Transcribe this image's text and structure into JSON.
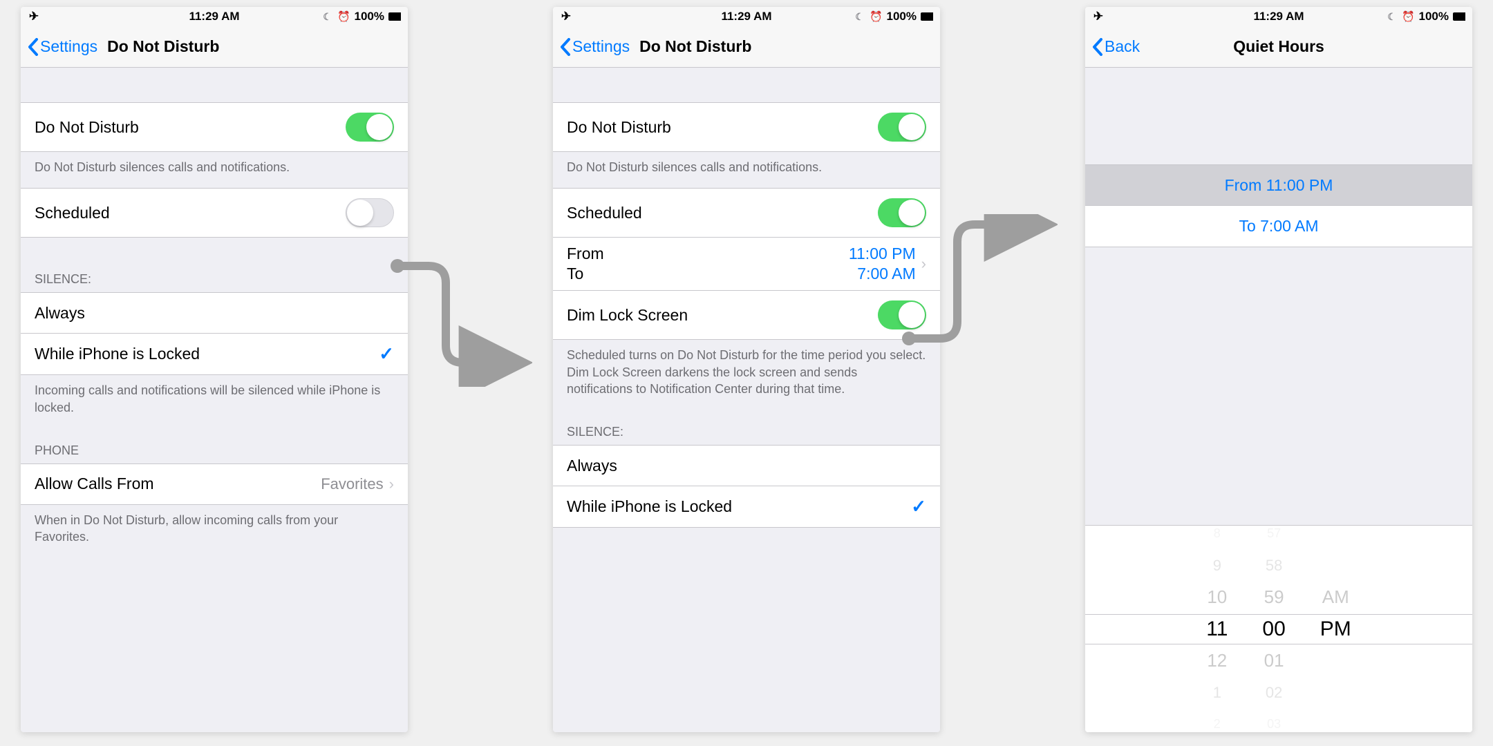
{
  "status_bar": {
    "time": "11:29 AM",
    "battery_text": "100%"
  },
  "screen1": {
    "back_label": "Settings",
    "title": "Do Not Disturb",
    "dnd_label": "Do Not Disturb",
    "dnd_footer": "Do Not Disturb silences calls and notifications.",
    "scheduled_label": "Scheduled",
    "silence_header": "SILENCE:",
    "always_label": "Always",
    "while_locked_label": "While iPhone is Locked",
    "silence_footer": "Incoming calls and notifications will be silenced while iPhone is locked.",
    "phone_header": "PHONE",
    "allow_calls_label": "Allow Calls From",
    "allow_calls_value": "Favorites",
    "allow_calls_footer": "When in Do Not Disturb, allow incoming calls from your Favorites."
  },
  "screen2": {
    "back_label": "Settings",
    "title": "Do Not Disturb",
    "dnd_label": "Do Not Disturb",
    "dnd_footer": "Do Not Disturb silences calls and notifications.",
    "scheduled_label": "Scheduled",
    "from_label": "From",
    "to_label": "To",
    "from_value": "11:00 PM",
    "to_value": "7:00 AM",
    "dim_label": "Dim Lock Screen",
    "scheduled_footer": "Scheduled turns on Do Not Disturb for the time period you select. Dim Lock Screen darkens the lock screen and sends notifications to Notification Center during that time.",
    "silence_header": "SILENCE:",
    "always_label": "Always",
    "while_locked_label": "While iPhone is Locked"
  },
  "screen3": {
    "back_label": "Back",
    "title": "Quiet Hours",
    "from_row": "From 11:00 PM",
    "to_row": "To 7:00 AM",
    "picker": {
      "hours": [
        "8",
        "9",
        "10",
        "11",
        "12",
        "1",
        "2"
      ],
      "minutes": [
        "57",
        "58",
        "59",
        "00",
        "01",
        "02",
        "03"
      ],
      "ampm": [
        "AM",
        "PM"
      ],
      "selected_hour": "11",
      "selected_minute": "00",
      "selected_ampm": "PM"
    }
  }
}
